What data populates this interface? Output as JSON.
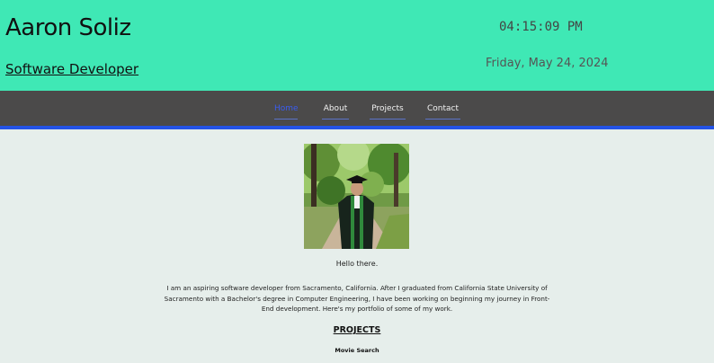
{
  "header": {
    "name": "Aaron Soliz",
    "role": "Software Developer",
    "time": "04:15:09 PM",
    "date": "Friday,  May 24, 2024"
  },
  "nav": {
    "items": [
      {
        "label": "Home",
        "active": true
      },
      {
        "label": "About",
        "active": false
      },
      {
        "label": "Projects",
        "active": false
      },
      {
        "label": "Contact",
        "active": false
      }
    ]
  },
  "main": {
    "greeting": "Hello there.",
    "intro": "I am an aspiring software developer from Sacramento, California. After  I graduated from California State University of Sacramento with a  Bachelor's degree in Computer Engineering,  I have been working on beginning my journey in Front-End development.  Here's my portfolio of some of my work.",
    "projects_heading": "PROJECTS",
    "projects": [
      "Movie Search"
    ]
  },
  "colors": {
    "header_bg": "#3fe8b5",
    "nav_bg": "#4b4a4a",
    "accent": "#2453e6",
    "page_bg": "#e6eeeb"
  }
}
